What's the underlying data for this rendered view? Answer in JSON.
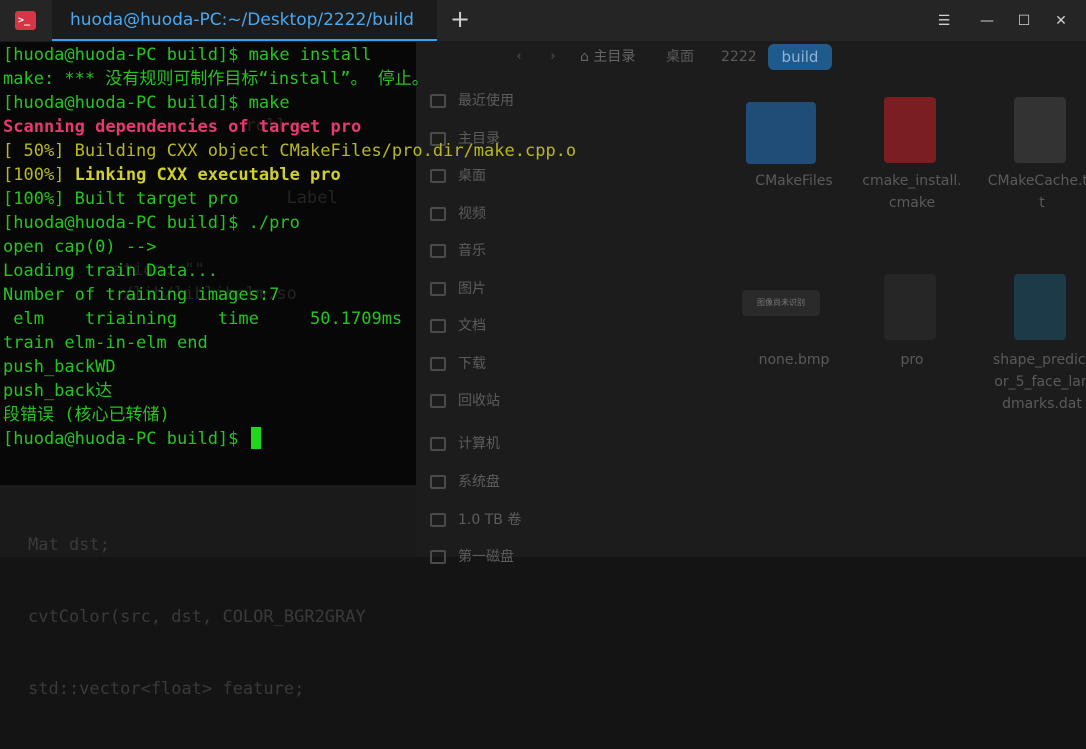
{
  "titlebar": {
    "app_icon_glyph": ">_",
    "tab_title": "huoda@huoda-PC:~/Desktop/2222/build",
    "add_tab_glyph": "+",
    "menu_glyph": "☰",
    "minimize_glyph": "—",
    "maximize_glyph": "☐",
    "close_glyph": "✕"
  },
  "file_manager": {
    "breadcrumbs": [
      "主目录",
      "桌面",
      "2222",
      "build"
    ],
    "sidebar": [
      {
        "label": "最近使用",
        "icon": "clock-icon"
      },
      {
        "label": "主目录",
        "icon": "home-icon"
      },
      {
        "label": "桌面",
        "icon": "desktop-icon"
      },
      {
        "label": "视频",
        "icon": "video-icon"
      },
      {
        "label": "音乐",
        "icon": "music-icon"
      },
      {
        "label": "图片",
        "icon": "picture-icon"
      },
      {
        "label": "文档",
        "icon": "document-icon"
      },
      {
        "label": "下载",
        "icon": "download-icon"
      },
      {
        "label": "回收站",
        "icon": "trash-icon"
      },
      {
        "label": "计算机",
        "icon": "computer-icon"
      },
      {
        "label": "系统盘",
        "icon": "disk-icon"
      },
      {
        "label": "1.0 TB 卷",
        "icon": "disk-icon"
      },
      {
        "label": "第一磁盘",
        "icon": "disk-icon"
      }
    ],
    "files": [
      {
        "name": "CMakeFiles",
        "type": "folder"
      },
      {
        "name": "cmake_install.\ncmake",
        "type": "cmake-file"
      },
      {
        "name": "CMakeCache.tx\nt",
        "type": "settings-file"
      },
      {
        "name": "none.bmp",
        "type": "image",
        "thumb_text": "图像尚未识别"
      },
      {
        "name": "pro",
        "type": "executable"
      },
      {
        "name": "shape_predict\nor_5_face_lan\ndmarks.dat",
        "type": "data-file"
      }
    ]
  },
  "terminal": {
    "lines": [
      [
        {
          "t": "[huoda@huoda-PC build]$ make install",
          "s": ""
        }
      ],
      [
        {
          "t": "make: *** 没有规则可制作目标“install”。 停止。",
          "s": ""
        }
      ],
      [
        {
          "t": "[huoda@huoda-PC build]$ make",
          "s": ""
        }
      ],
      [
        {
          "t": "Scanning dependencies of target pro",
          "s": "c-pink"
        }
      ],
      [
        {
          "t": "[ 50%] Building CXX object CMakeFiles/pro.dir/make.cpp.o",
          "s": "c-olive"
        }
      ],
      [
        {
          "t": "[100%] ",
          "s": "c-olive"
        },
        {
          "t": "Linking CXX executable pro",
          "s": "c-olive-bold"
        }
      ],
      [
        {
          "t": "[100%] Built target pro",
          "s": ""
        }
      ],
      [
        {
          "t": "[huoda@huoda-PC build]$ ./pro",
          "s": ""
        }
      ],
      [
        {
          "t": "open cap(0) -->",
          "s": ""
        }
      ],
      [
        {
          "t": "Loading train Data...",
          "s": ""
        }
      ],
      [
        {
          "t": "Number of training images:7",
          "s": ""
        }
      ],
      [
        {
          "t": " elm    triaining    time     50.1709ms",
          "s": ""
        }
      ],
      [
        {
          "t": "train elm-in-elm end",
          "s": ""
        }
      ],
      [
        {
          "t": "push_backWD",
          "s": ""
        }
      ],
      [
        {
          "t": "push_back达",
          "s": ""
        }
      ],
      [
        {
          "t": "段错误 (核心已转储)",
          "s": ""
        }
      ],
      [
        {
          "t": "[huoda@huoda-PC build]$ ",
          "s": ""
        }
      ]
    ],
    "background_code": [
      "",
      "",
      "         ",
      "                        roll",
      "",
      "",
      "                            Label",
      "",
      "",
      "           ation: \"\"",
      "            /lib/liblibelm.so",
      "",
      "",
      "",
      "",
      "",
      "",
      "",
      "",
      "",
      "",
      "Mat dst;",
      "cvtColor(src, dst, COLOR_BGR2GRAY",
      "std::vector<float> feature;"
    ]
  },
  "colors": {
    "accent": "#2ca7f8",
    "terminal_green": "#26c421",
    "error_pink": "#e6396f",
    "make_olive": "#b8b81f"
  }
}
